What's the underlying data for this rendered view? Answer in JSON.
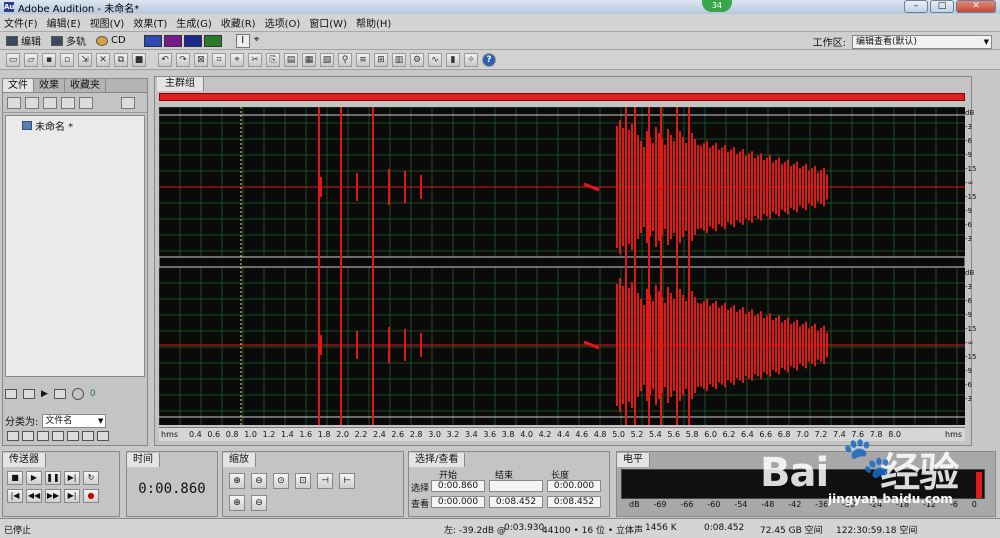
{
  "window": {
    "title": "Adobe Audition - 未命名*",
    "badge": "34",
    "app_icon": "Au"
  },
  "menu": [
    "文件(F)",
    "编辑(E)",
    "视图(V)",
    "效果(T)",
    "生成(G)",
    "收藏(R)",
    "选项(O)",
    "窗口(W)",
    "帮助(H)"
  ],
  "modes": {
    "edit": "编辑",
    "multitrack": "多轨",
    "cd": "CD"
  },
  "workspace": {
    "label": "工作区:",
    "value": "编辑查看(默认)"
  },
  "left_panel": {
    "tabs": [
      "文件",
      "效果",
      "收藏夹"
    ],
    "files": [
      {
        "name": "未命名 *"
      }
    ],
    "sort_label": "分类为:",
    "sort_value": "文件名",
    "volume_value": "0"
  },
  "main": {
    "tab": "主群组",
    "ruler_unit": "hms",
    "ruler_ticks": [
      "0.4",
      "0.6",
      "0.8",
      "1.0",
      "1.2",
      "1.4",
      "1.6",
      "1.8",
      "2.0",
      "2.2",
      "2.4",
      "2.6",
      "2.8",
      "3.0",
      "3.2",
      "3.4",
      "3.6",
      "3.8",
      "4.0",
      "4.2",
      "4.4",
      "4.6",
      "4.8",
      "5.0",
      "5.2",
      "5.4",
      "5.6",
      "5.8",
      "6.0",
      "6.2",
      "6.4",
      "6.6",
      "6.8",
      "7.0",
      "7.2",
      "7.4",
      "7.6",
      "7.8",
      "8.0"
    ],
    "db_labels": [
      "dB",
      "-3",
      "-6",
      "-9",
      "-15",
      "-∞",
      "-15",
      "-9",
      "-6",
      "-3"
    ]
  },
  "transport": {
    "tab": "传送器"
  },
  "time": {
    "tab": "时间",
    "value": "0:00.860"
  },
  "zoom": {
    "tab": "缩放"
  },
  "selection": {
    "tab": "选择/查看",
    "headers": [
      "开始",
      "结束",
      "长度"
    ],
    "rows": [
      {
        "label": "选择",
        "start": "0:00.860",
        "end": "",
        "length": "0:00.000"
      },
      {
        "label": "查看",
        "start": "0:00.000",
        "end": "0:08.452",
        "length": "0:08.452"
      }
    ]
  },
  "levels": {
    "tab": "电平",
    "scale": [
      "dB",
      "-69",
      "-66",
      "-60",
      "-54",
      "-48",
      "-42",
      "-36",
      "-30",
      "-24",
      "-18",
      "-12",
      "-6",
      "0"
    ]
  },
  "status": {
    "state": "已停止",
    "left": "左: -39.2dB @",
    "cursor_time": "0:03.930",
    "format": "44100 • 16 位 • 立体声",
    "size": "1456 K",
    "duration": "0:08.452",
    "disk": "72.45 GB 空间",
    "free_time": "122:30:59.18 空间"
  },
  "watermark": {
    "brand": "Bai",
    "brand2": "经验",
    "url": "jingyan.baidu.com"
  },
  "colors": {
    "waveform": "#e01818",
    "background": "#0a0a0a",
    "grid": "#1e4e1e"
  }
}
